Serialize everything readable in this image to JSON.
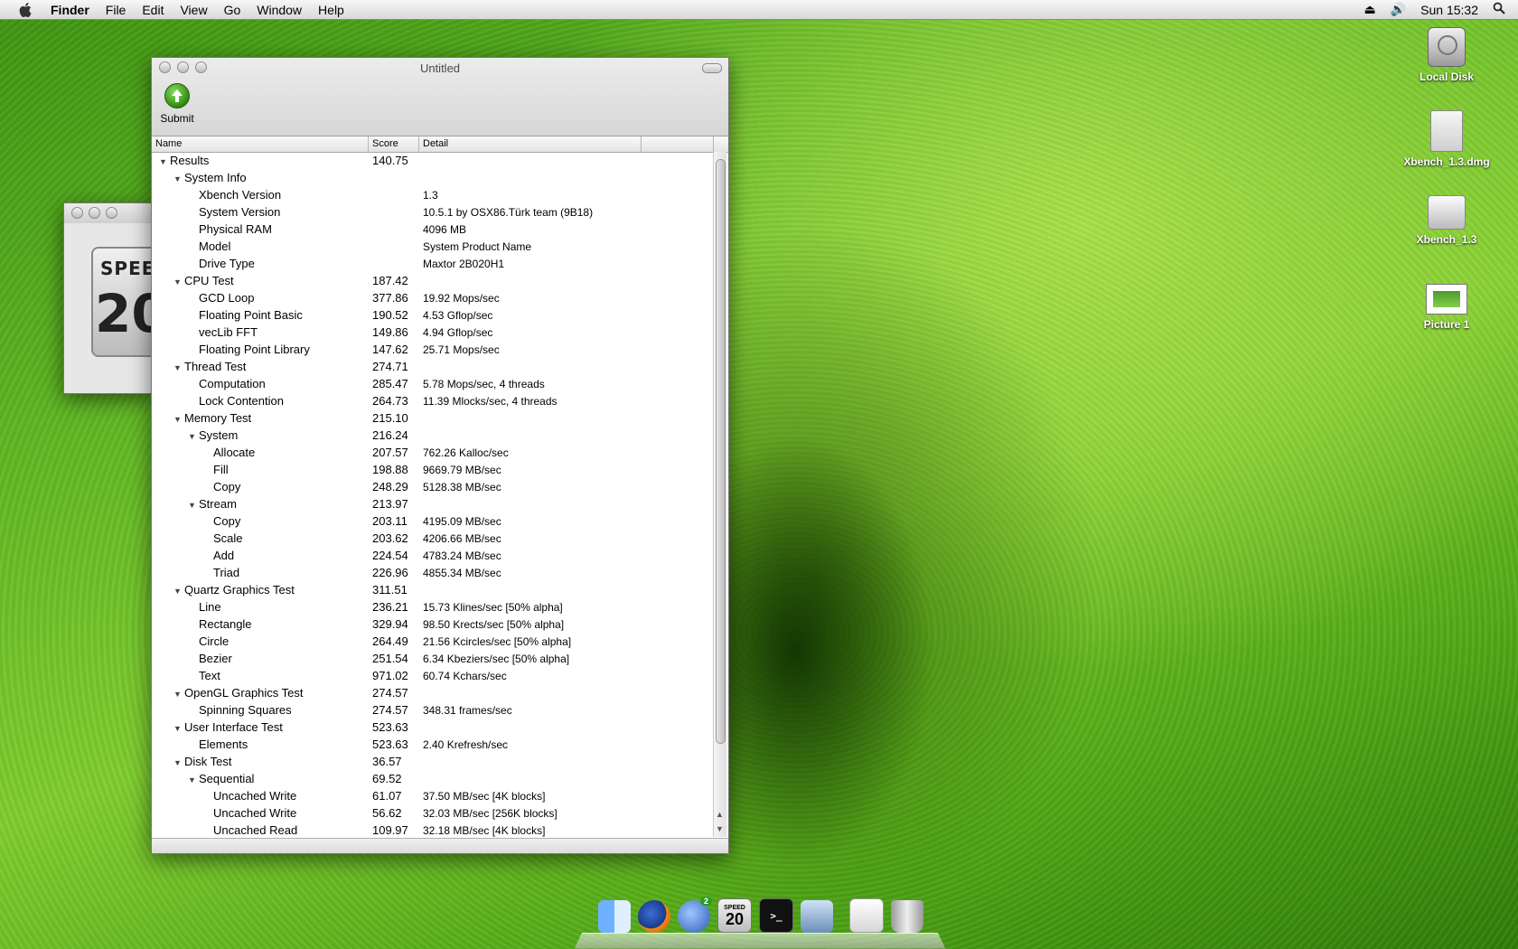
{
  "menubar": {
    "app": "Finder",
    "menus": [
      "File",
      "Edit",
      "View",
      "Go",
      "Window",
      "Help"
    ],
    "clock": "Sun 15:32"
  },
  "window": {
    "title": "Untitled",
    "toolbar": {
      "submit_label": "Submit"
    },
    "columns": {
      "name": "Name",
      "score": "Score",
      "detail": "Detail"
    },
    "rows": [
      {
        "name": "Results",
        "score": "140.75",
        "detail": "",
        "level": 0,
        "expanded": true
      },
      {
        "name": "System Info",
        "score": "",
        "detail": "",
        "level": 1,
        "expanded": true
      },
      {
        "name": "Xbench Version",
        "score": "",
        "detail": "1.3",
        "level": 2
      },
      {
        "name": "System Version",
        "score": "",
        "detail": "10.5.1 by OSX86.Türk team (9B18)",
        "level": 2
      },
      {
        "name": "Physical RAM",
        "score": "",
        "detail": "4096 MB",
        "level": 2
      },
      {
        "name": "Model",
        "score": "",
        "detail": "System Product Name",
        "level": 2
      },
      {
        "name": "Drive Type",
        "score": "",
        "detail": "Maxtor 2B020H1",
        "level": 2
      },
      {
        "name": "CPU Test",
        "score": "187.42",
        "detail": "",
        "level": 1,
        "expanded": true
      },
      {
        "name": "GCD Loop",
        "score": "377.86",
        "detail": "19.92 Mops/sec",
        "level": 2
      },
      {
        "name": "Floating Point Basic",
        "score": "190.52",
        "detail": "4.53 Gflop/sec",
        "level": 2
      },
      {
        "name": "vecLib FFT",
        "score": "149.86",
        "detail": "4.94 Gflop/sec",
        "level": 2
      },
      {
        "name": "Floating Point Library",
        "score": "147.62",
        "detail": "25.71 Mops/sec",
        "level": 2
      },
      {
        "name": "Thread Test",
        "score": "274.71",
        "detail": "",
        "level": 1,
        "expanded": true
      },
      {
        "name": "Computation",
        "score": "285.47",
        "detail": "5.78 Mops/sec, 4 threads",
        "level": 2
      },
      {
        "name": "Lock Contention",
        "score": "264.73",
        "detail": "11.39 Mlocks/sec, 4 threads",
        "level": 2
      },
      {
        "name": "Memory Test",
        "score": "215.10",
        "detail": "",
        "level": 1,
        "expanded": true
      },
      {
        "name": "System",
        "score": "216.24",
        "detail": "",
        "level": 2,
        "expanded": true
      },
      {
        "name": "Allocate",
        "score": "207.57",
        "detail": "762.26 Kalloc/sec",
        "level": 3
      },
      {
        "name": "Fill",
        "score": "198.88",
        "detail": "9669.79 MB/sec",
        "level": 3
      },
      {
        "name": "Copy",
        "score": "248.29",
        "detail": "5128.38 MB/sec",
        "level": 3
      },
      {
        "name": "Stream",
        "score": "213.97",
        "detail": "",
        "level": 2,
        "expanded": true
      },
      {
        "name": "Copy",
        "score": "203.11",
        "detail": "4195.09 MB/sec",
        "level": 3
      },
      {
        "name": "Scale",
        "score": "203.62",
        "detail": "4206.66 MB/sec",
        "level": 3
      },
      {
        "name": "Add",
        "score": "224.54",
        "detail": "4783.24 MB/sec",
        "level": 3
      },
      {
        "name": "Triad",
        "score": "226.96",
        "detail": "4855.34 MB/sec",
        "level": 3
      },
      {
        "name": "Quartz Graphics Test",
        "score": "311.51",
        "detail": "",
        "level": 1,
        "expanded": true
      },
      {
        "name": "Line",
        "score": "236.21",
        "detail": "15.73 Klines/sec [50% alpha]",
        "level": 2
      },
      {
        "name": "Rectangle",
        "score": "329.94",
        "detail": "98.50 Krects/sec [50% alpha]",
        "level": 2
      },
      {
        "name": "Circle",
        "score": "264.49",
        "detail": "21.56 Kcircles/sec [50% alpha]",
        "level": 2
      },
      {
        "name": "Bezier",
        "score": "251.54",
        "detail": "6.34 Kbeziers/sec [50% alpha]",
        "level": 2
      },
      {
        "name": "Text",
        "score": "971.02",
        "detail": "60.74 Kchars/sec",
        "level": 2
      },
      {
        "name": "OpenGL Graphics Test",
        "score": "274.57",
        "detail": "",
        "level": 1,
        "expanded": true
      },
      {
        "name": "Spinning Squares",
        "score": "274.57",
        "detail": "348.31 frames/sec",
        "level": 2
      },
      {
        "name": "User Interface Test",
        "score": "523.63",
        "detail": "",
        "level": 1,
        "expanded": true
      },
      {
        "name": "Elements",
        "score": "523.63",
        "detail": "2.40 Krefresh/sec",
        "level": 2
      },
      {
        "name": "Disk Test",
        "score": "36.57",
        "detail": "",
        "level": 1,
        "expanded": true
      },
      {
        "name": "Sequential",
        "score": "69.52",
        "detail": "",
        "level": 2,
        "expanded": true
      },
      {
        "name": "Uncached Write",
        "score": "61.07",
        "detail": "37.50 MB/sec [4K blocks]",
        "level": 3
      },
      {
        "name": "Uncached Write",
        "score": "56.62",
        "detail": "32.03 MB/sec [256K blocks]",
        "level": 3
      },
      {
        "name": "Uncached Read",
        "score": "109.97",
        "detail": "32.18 MB/sec [4K blocks]",
        "level": 3
      }
    ]
  },
  "desktop_icons": [
    {
      "label": "Local Disk",
      "icon": "hard-disk-icon"
    },
    {
      "label": "Xbench_1.3.dmg",
      "icon": "disk-image-icon"
    },
    {
      "label": "Xbench_1.3",
      "icon": "volume-icon"
    },
    {
      "label": "Picture 1",
      "icon": "picture-file-icon"
    }
  ],
  "dock": {
    "items": [
      "finder-icon",
      "firefox-icon",
      "thunderbird-icon",
      "xbench-icon",
      "terminal-icon",
      "preview-icon",
      "mail-stack-icon",
      "trash-icon"
    ],
    "thunderbird_badge": "2",
    "xbench_label": "SPEED",
    "xbench_number": "20"
  },
  "background_window": {
    "logo_word": "SPEE",
    "logo_number": "20"
  }
}
